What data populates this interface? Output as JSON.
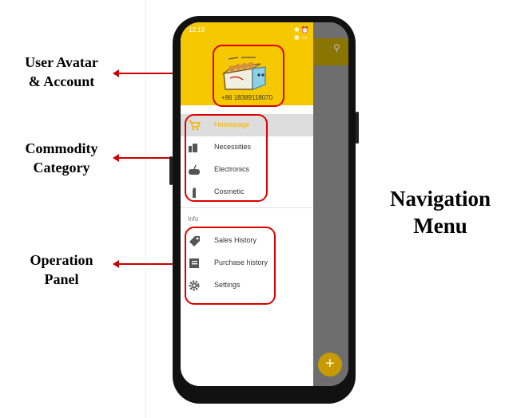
{
  "annotations": {
    "avatar": [
      "User Avatar",
      "& Account"
    ],
    "category": [
      "Commodity",
      "Category"
    ],
    "operation": [
      "Operation",
      "Panel"
    ],
    "navigation": [
      "Navigation",
      "Menu"
    ]
  },
  "status_bar": {
    "time": "12:19",
    "right": "✱ ⏰ ◉ ▭"
  },
  "account": {
    "phone_number": "+86 18389118070"
  },
  "menu": {
    "categories": [
      {
        "label": "Homepage",
        "icon": "cart-icon",
        "active": true
      },
      {
        "label": "Necessities",
        "icon": "necessities-icon",
        "active": false
      },
      {
        "label": "Electronics",
        "icon": "gamepad-icon",
        "active": false
      },
      {
        "label": "Cosmetic",
        "icon": "cosmetic-icon",
        "active": false
      }
    ],
    "section_label": "Info",
    "operations": [
      {
        "label": "Sales History",
        "icon": "tag-icon"
      },
      {
        "label": "Purchase history",
        "icon": "book-icon"
      },
      {
        "label": "Settings",
        "icon": "gear-icon"
      }
    ]
  },
  "fab_label": "+",
  "colors": {
    "accent": "#f5c800",
    "highlight": "#e00000",
    "active_text": "#f1b400"
  }
}
